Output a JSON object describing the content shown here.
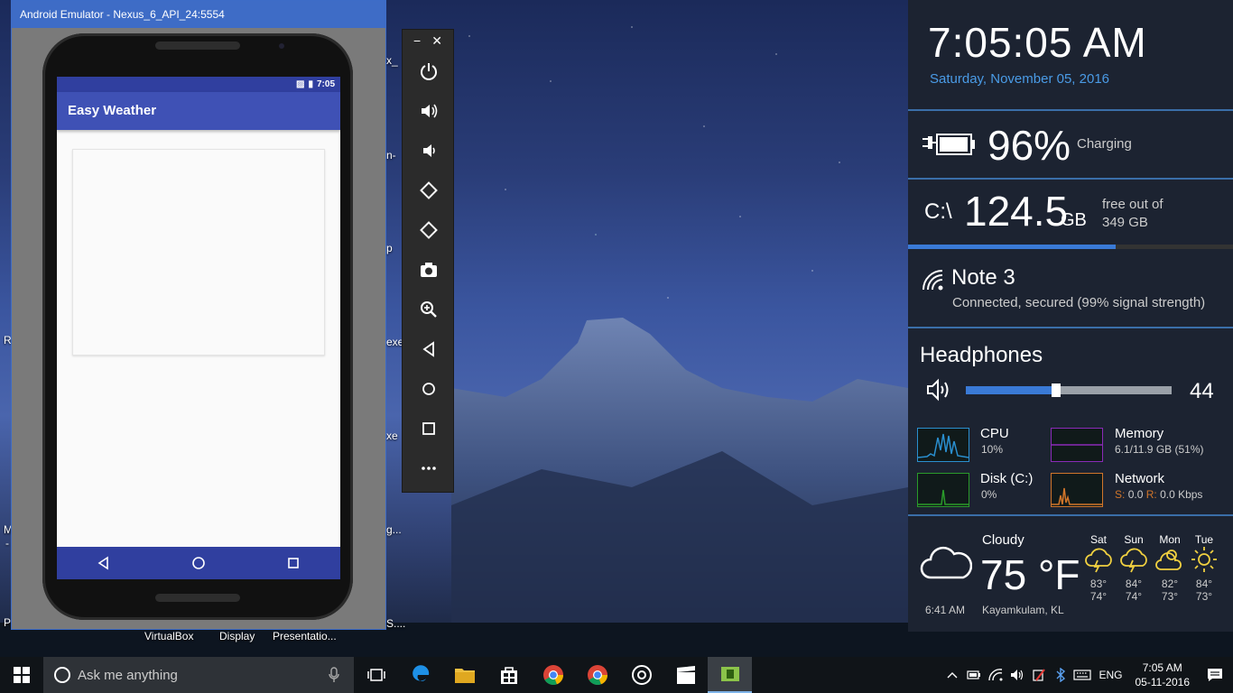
{
  "emulator": {
    "title": "Android Emulator - Nexus_6_API_24:5554",
    "status_time": "7:05",
    "app_title": "Easy Weather",
    "toolbar_minimize": "−",
    "toolbar_close": "✕"
  },
  "desktop": {
    "labels": [
      "x_",
      "n-",
      "p",
      "exe",
      "xe",
      "Ri",
      "Pl",
      "M",
      "-",
      "g...",
      "S...."
    ],
    "bottom_labels": [
      "VirtualBox",
      "Display",
      "Presentatio..."
    ]
  },
  "panel": {
    "time": "7:05:05 AM",
    "date": "Saturday, November 05, 2016",
    "battery_percent": "96%",
    "battery_state": "Charging",
    "drive_label": "C:\\",
    "drive_free": "124.5",
    "drive_unit": "GB",
    "drive_desc_1": "free out of",
    "drive_desc_2": "349 GB",
    "drive_fill_fraction": 0.64,
    "wifi_name": "Note 3",
    "wifi_status": "Connected, secured (99% signal strength)",
    "audio_device": "Headphones",
    "volume_value": "44",
    "volume_fraction": 0.44,
    "cpu_name": "CPU",
    "cpu_value": "10%",
    "memory_name": "Memory",
    "memory_value": "6.1/11.9 GB (51%)",
    "disk_name": "Disk (C:)",
    "disk_value": "0%",
    "network_name": "Network",
    "network_s_label": "S:",
    "network_s_value": "0.0",
    "network_r_label": "R:",
    "network_r_value": "0.0 Kbps",
    "weather_condition": "Cloudy",
    "weather_temp": "75 °F",
    "weather_time": "6:41 AM",
    "weather_location": "Kayamkulam, KL",
    "forecast": [
      {
        "day": "Sat",
        "hi": "83°",
        "lo": "74°",
        "icon": "storm-cloud-icon"
      },
      {
        "day": "Sun",
        "hi": "84°",
        "lo": "74°",
        "icon": "storm-cloud-icon"
      },
      {
        "day": "Mon",
        "hi": "82°",
        "lo": "73°",
        "icon": "partly-sunny-icon"
      },
      {
        "day": "Tue",
        "hi": "84°",
        "lo": "73°",
        "icon": "sun-icon"
      }
    ],
    "colors": {
      "accent": "#3a7ad6",
      "date": "#4a9be6",
      "cpu": "#2a8fcf",
      "memory": "#8a2ab8",
      "disk": "#2a9a2a",
      "network": "#d0752a"
    }
  },
  "taskbar": {
    "search_placeholder": "Ask me anything",
    "language": "ENG",
    "time": "7:05 AM",
    "date": "05-11-2016"
  }
}
